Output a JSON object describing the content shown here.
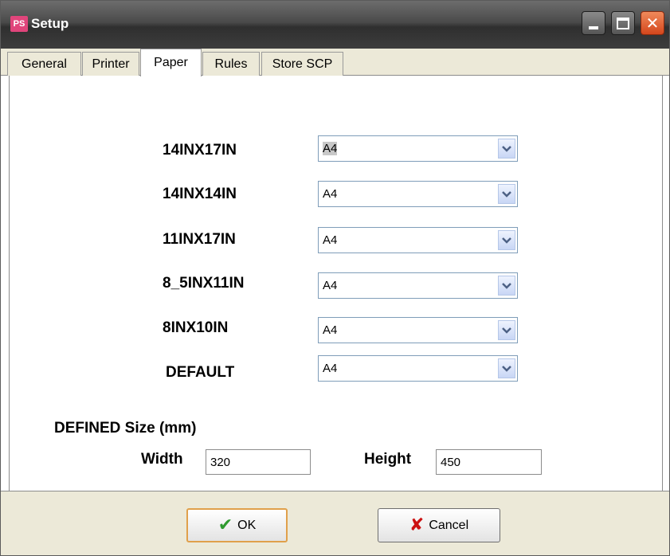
{
  "window": {
    "title": "Setup",
    "app_icon": "PS"
  },
  "tabs": [
    {
      "label": "General",
      "active": false
    },
    {
      "label": "Printer",
      "active": false
    },
    {
      "label": "Paper",
      "active": true
    },
    {
      "label": "Rules",
      "active": false
    },
    {
      "label": "Store SCP",
      "active": false
    }
  ],
  "paper_sizes": [
    {
      "label": "14INX17IN",
      "value": "A4"
    },
    {
      "label": "14INX14IN",
      "value": "A4"
    },
    {
      "label": "11INX17IN",
      "value": "A4"
    },
    {
      "label": "8_5INX11IN",
      "value": "A4"
    },
    {
      "label": "8INX10IN",
      "value": "A4"
    },
    {
      "label": "DEFAULT",
      "value": "A4"
    }
  ],
  "defined_size": {
    "heading": "DEFINED Size (mm)",
    "width_label": "Width",
    "width_value": "320",
    "height_label": "Height",
    "height_value": "450"
  },
  "buttons": {
    "ok": "OK",
    "cancel": "Cancel"
  },
  "icons": {
    "app": "app-logo-icon",
    "minimize": "minimize-icon",
    "maximize": "maximize-icon",
    "close": "close-icon",
    "dropdown": "chevron-down-icon",
    "ok": "checkmark-icon",
    "cancel": "x-mark-icon"
  },
  "colors": {
    "close_button": "#d4461c",
    "default_button_border": "#e0a04b",
    "ok_check": "#2e9a2e",
    "cancel_x": "#cc1111"
  }
}
